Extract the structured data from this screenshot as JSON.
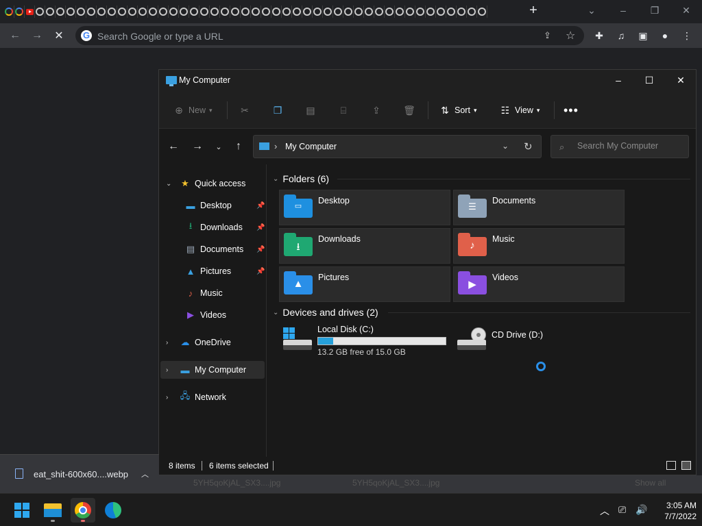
{
  "browser": {
    "omnibox_placeholder": "Search Google or type a URL"
  },
  "explorer": {
    "title": "My Computer",
    "commands": {
      "new": "New",
      "sort": "Sort",
      "view": "View"
    },
    "breadcrumb": "My Computer",
    "search_placeholder": "Search My Computer",
    "nav": {
      "quick_access": "Quick access",
      "items": [
        {
          "label": "Desktop",
          "pinned": true
        },
        {
          "label": "Downloads",
          "pinned": true
        },
        {
          "label": "Documents",
          "pinned": true
        },
        {
          "label": "Pictures",
          "pinned": true
        },
        {
          "label": "Music",
          "pinned": false
        },
        {
          "label": "Videos",
          "pinned": false
        }
      ],
      "onedrive": "OneDrive",
      "my_computer": "My Computer",
      "network": "Network"
    },
    "folders_header": "Folders (6)",
    "folders": [
      {
        "label": "Desktop",
        "color": "#1e90e0"
      },
      {
        "label": "Documents",
        "color": "#8fa3b8"
      },
      {
        "label": "Downloads",
        "color": "#1fa872"
      },
      {
        "label": "Music",
        "color": "#e0604a"
      },
      {
        "label": "Pictures",
        "color": "#2a8fe8"
      },
      {
        "label": "Videos",
        "color": "#8a4fe0"
      }
    ],
    "drives_header": "Devices and drives (2)",
    "drives": [
      {
        "label": "Local Disk (C:)",
        "free_text": "13.2 GB free of 15.0 GB",
        "used_fraction": 0.12
      },
      {
        "label": "CD Drive (D:)"
      }
    ],
    "status": {
      "items": "8 items",
      "selected": "6 items selected"
    }
  },
  "downloads_shelf": {
    "filename": "eat_shit-600x60....webp",
    "ghost1": "5YH5qoKjAL_SX3....jpg",
    "ghost2": "5YH5qoKjAL_SX3....jpg",
    "ghost3": "Show all"
  },
  "taskbar": {
    "time": "3:05 AM",
    "date": "7/7/2022"
  }
}
